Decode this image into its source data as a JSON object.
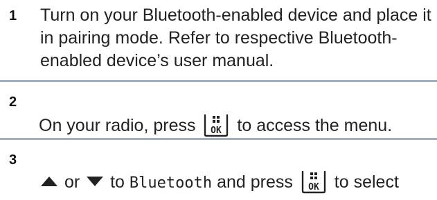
{
  "steps": [
    {
      "number": "1",
      "text": "Turn on your Bluetooth-enabled device and place it in pairing mode. Refer to respective Bluetooth-enabled device’s user manual."
    },
    {
      "number": "2",
      "text_before": "On your radio, press",
      "key_icon": "menu-ok-key-icon",
      "text_after": "to access the menu."
    },
    {
      "number": "3",
      "arrow_up_icon": "up-arrow-icon",
      "or_text": "or",
      "arrow_down_icon": "down-arrow-icon",
      "to_text": "to",
      "menu_item": "Bluetooth",
      "and_press_text": "and press",
      "key_icon": "menu-ok-key-icon",
      "text_after": "to select"
    }
  ],
  "key_label": "OK",
  "colors": {
    "divider": "#9fb0bc",
    "text": "#222222"
  }
}
